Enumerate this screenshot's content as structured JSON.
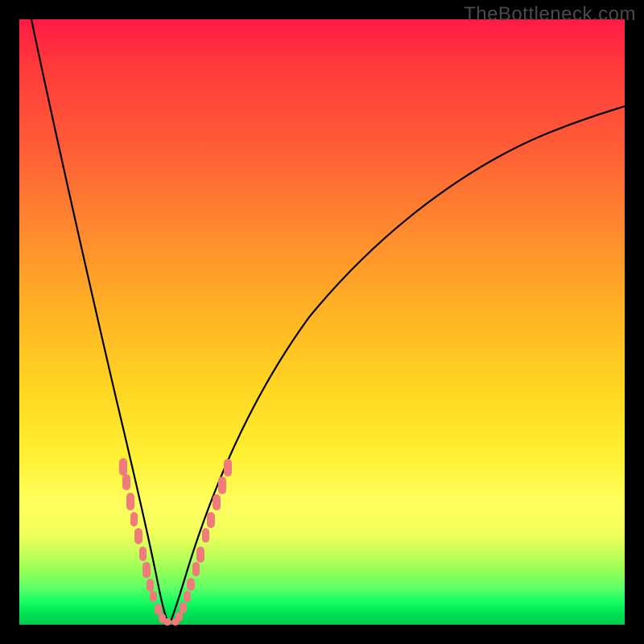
{
  "watermark": "TheBottleneck.com",
  "colors": {
    "frame": "#000000",
    "gradient_top": "#ff1a44",
    "gradient_mid": "#ffd321",
    "gradient_bottom": "#00c94b",
    "curve": "#000000",
    "bead": "#f07b7b"
  },
  "chart_data": {
    "type": "line",
    "title": "",
    "xlabel": "",
    "ylabel": "",
    "xlim": [
      0,
      100
    ],
    "ylim": [
      0,
      100
    ],
    "grid": false,
    "legend": false,
    "series": [
      {
        "name": "left-branch",
        "x": [
          2,
          4,
          6,
          8,
          10,
          12,
          14,
          16,
          18,
          19,
          20,
          21,
          22,
          23,
          24
        ],
        "y": [
          100,
          90,
          80,
          70,
          60,
          50,
          40,
          32,
          22,
          16,
          10,
          6,
          3,
          1,
          0
        ]
      },
      {
        "name": "right-branch",
        "x": [
          24,
          25,
          26,
          27,
          28,
          30,
          33,
          38,
          45,
          55,
          65,
          75,
          85,
          95,
          100
        ],
        "y": [
          0,
          1,
          3,
          6,
          10,
          18,
          28,
          40,
          52,
          62,
          70,
          76,
          80,
          84,
          86
        ]
      }
    ],
    "markers": [
      {
        "name": "left-beads",
        "x": [
          17.3,
          17.8,
          18.5,
          19.2,
          19.8,
          20.4,
          20.9,
          21.3,
          21.6,
          22.5,
          23.0,
          23.5,
          24.0
        ],
        "y": [
          27,
          24,
          20,
          16,
          12,
          9,
          7,
          5.5,
          4.5,
          2.5,
          1.5,
          0.7,
          0.2
        ]
      },
      {
        "name": "right-beads",
        "x": [
          24.5,
          25.0,
          25.5,
          26.0,
          26.4,
          27.2,
          27.8,
          28.5,
          29.2,
          30.0,
          30.8,
          31.5,
          32.2
        ],
        "y": [
          0.3,
          0.8,
          1.6,
          3,
          4.2,
          7,
          9,
          12,
          15,
          18,
          21,
          24,
          27
        ]
      }
    ]
  }
}
